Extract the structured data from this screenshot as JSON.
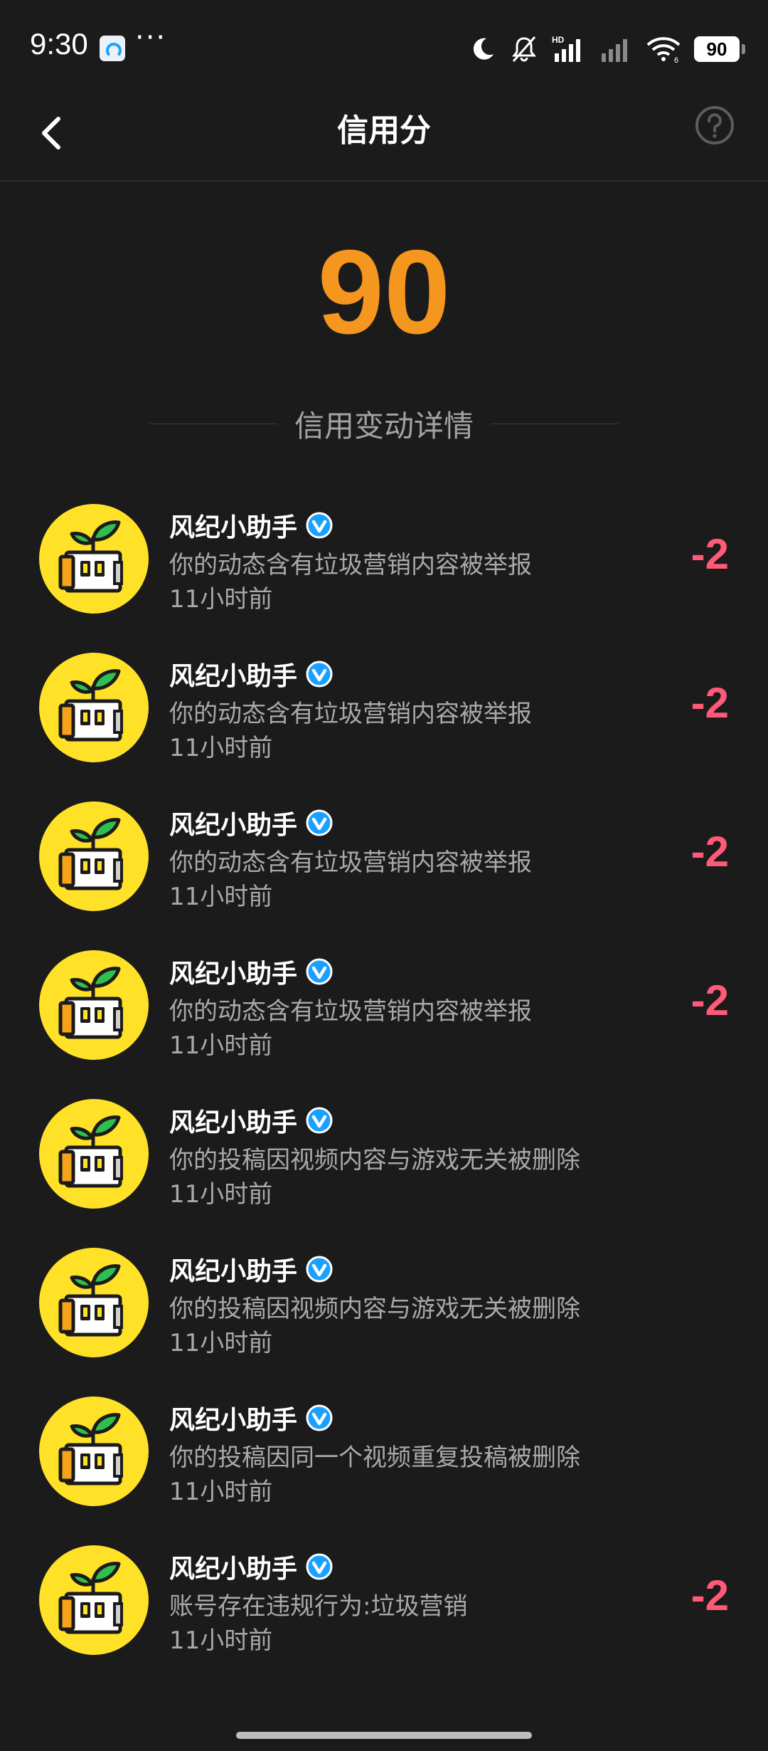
{
  "status_bar": {
    "time": "9:30",
    "dots": "···",
    "network_label": "HD",
    "wifi_label": "6",
    "battery": "90"
  },
  "header": {
    "title": "信用分",
    "back_icon": "chevron-left-icon",
    "help_icon": "question-circle-icon"
  },
  "score": {
    "value": "90",
    "color": "#f5961e"
  },
  "section": {
    "title": "信用变动详情"
  },
  "records": [
    {
      "name": "风纪小助手",
      "desc": "你的动态含有垃圾营销内容被举报",
      "time": "11小时前",
      "delta": "-2"
    },
    {
      "name": "风纪小助手",
      "desc": "你的动态含有垃圾营销内容被举报",
      "time": "11小时前",
      "delta": "-2"
    },
    {
      "name": "风纪小助手",
      "desc": "你的动态含有垃圾营销内容被举报",
      "time": "11小时前",
      "delta": "-2"
    },
    {
      "name": "风纪小助手",
      "desc": "你的动态含有垃圾营销内容被举报",
      "time": "11小时前",
      "delta": "-2"
    },
    {
      "name": "风纪小助手",
      "desc": "你的投稿因视频内容与游戏无关被删除",
      "time": "11小时前",
      "delta": ""
    },
    {
      "name": "风纪小助手",
      "desc": "你的投稿因视频内容与游戏无关被删除",
      "time": "11小时前",
      "delta": ""
    },
    {
      "name": "风纪小助手",
      "desc": "你的投稿因同一个视频重复投稿被删除",
      "time": "11小时前",
      "delta": ""
    },
    {
      "name": "风纪小助手",
      "desc": "账号存在违规行为:垃圾营销",
      "time": "11小时前",
      "delta": "-2"
    }
  ],
  "colors": {
    "background": "#1b1b1c",
    "delta": "#ff5a78",
    "avatar_bg": "#ffe227",
    "verified": "#1aa1ff"
  }
}
